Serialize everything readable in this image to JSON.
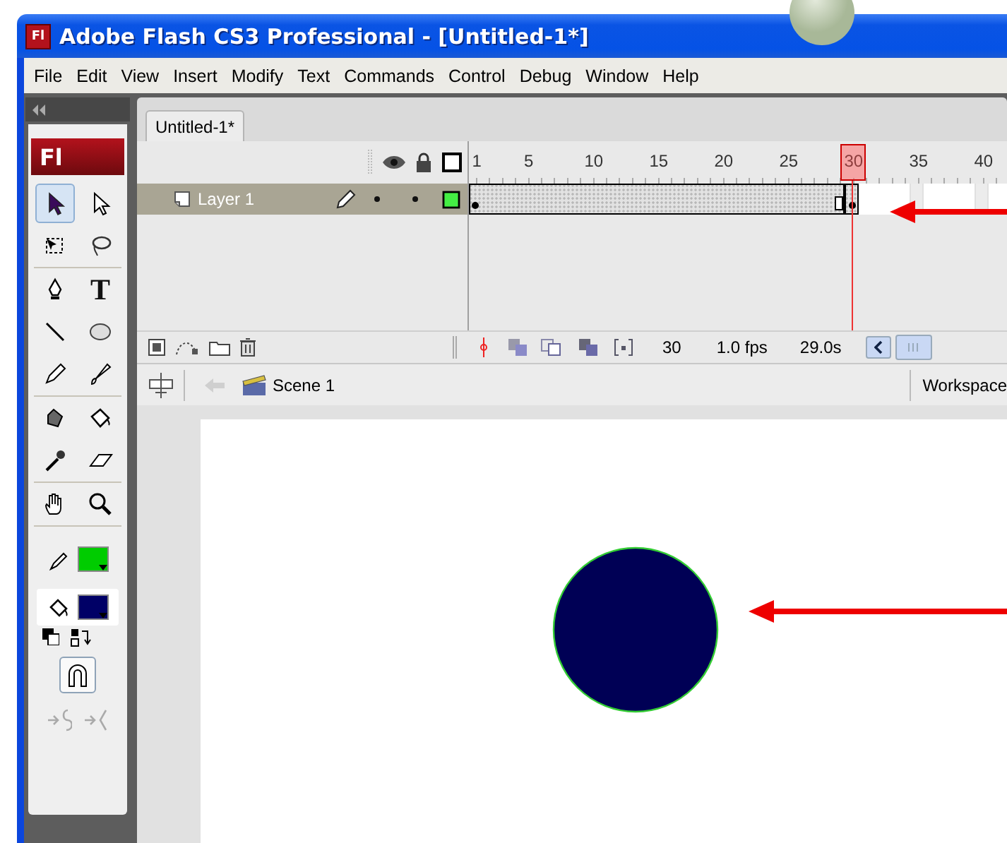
{
  "window": {
    "icon": "Fl",
    "title": "Adobe Flash CS3 Professional - [Untitled-1*]"
  },
  "menu": [
    {
      "label": "File"
    },
    {
      "label": "Edit"
    },
    {
      "label": "View"
    },
    {
      "label": "Insert"
    },
    {
      "label": "Modify"
    },
    {
      "label": "Text"
    },
    {
      "label": "Commands"
    },
    {
      "label": "Control"
    },
    {
      "label": "Debug"
    },
    {
      "label": "Window"
    },
    {
      "label": "Help"
    }
  ],
  "tools": {
    "logo": "Fl",
    "groups": [
      [
        {
          "kind": "selection",
          "selected": true
        },
        {
          "kind": "subselection",
          "selected": false
        },
        {
          "kind": "free-transform",
          "selected": false
        },
        {
          "kind": "lasso",
          "selected": false
        }
      ],
      [
        {
          "kind": "pen",
          "selected": false
        },
        {
          "kind": "text",
          "glyph": "T",
          "selected": false
        },
        {
          "kind": "line",
          "selected": false
        },
        {
          "kind": "oval",
          "selected": false
        },
        {
          "kind": "pencil",
          "selected": false
        },
        {
          "kind": "brush",
          "selected": false
        }
      ],
      [
        {
          "kind": "ink-bottle",
          "selected": false
        },
        {
          "kind": "paint-bucket",
          "selected": false
        },
        {
          "kind": "eyedropper",
          "selected": false
        },
        {
          "kind": "eraser",
          "selected": false
        }
      ],
      [
        {
          "kind": "hand",
          "selected": false
        },
        {
          "kind": "zoom",
          "selected": false
        }
      ]
    ],
    "colors": [
      {
        "kind": "stroke",
        "color": "#00cc00",
        "selected": false
      },
      {
        "kind": "fill",
        "color": "#000066",
        "selected": true
      }
    ],
    "snap": {
      "on": true
    },
    "modifiers": [
      {
        "kind": "smooth",
        "disabled": true
      },
      {
        "kind": "straighten",
        "disabled": true
      }
    ]
  },
  "documents": [
    {
      "label": "Untitled-1*",
      "selected": true
    }
  ],
  "timeline": {
    "ruler": [
      {
        "label": "1",
        "selected": false
      },
      {
        "label": "5",
        "selected": false
      },
      {
        "label": "10",
        "selected": false
      },
      {
        "label": "15",
        "selected": false
      },
      {
        "label": "20",
        "selected": false
      },
      {
        "label": "25",
        "selected": false
      },
      {
        "label": "30",
        "selected": true
      },
      {
        "label": "35",
        "selected": false
      },
      {
        "label": "40",
        "selected": false
      }
    ],
    "layers": [
      {
        "name": "Layer 1",
        "selected": true,
        "editing": true,
        "visible": true,
        "locked": false,
        "color": "#44ee44",
        "frames": [
          {
            "kind": "keyframe"
          },
          {
            "kind": "frame"
          },
          {
            "kind": "frame"
          },
          {
            "kind": "frame"
          },
          {
            "kind": "frame"
          },
          {
            "kind": "frame"
          },
          {
            "kind": "frame"
          },
          {
            "kind": "frame"
          },
          {
            "kind": "frame"
          },
          {
            "kind": "frame"
          },
          {
            "kind": "frame"
          },
          {
            "kind": "frame"
          },
          {
            "kind": "frame"
          },
          {
            "kind": "frame"
          },
          {
            "kind": "frame"
          },
          {
            "kind": "frame"
          },
          {
            "kind": "frame"
          },
          {
            "kind": "frame"
          },
          {
            "kind": "frame"
          },
          {
            "kind": "frame"
          },
          {
            "kind": "frame"
          },
          {
            "kind": "frame"
          },
          {
            "kind": "frame"
          },
          {
            "kind": "frame"
          },
          {
            "kind": "frame"
          },
          {
            "kind": "frame"
          },
          {
            "kind": "frame"
          },
          {
            "kind": "frame"
          },
          {
            "kind": "end"
          },
          {
            "kind": "keyframe"
          }
        ]
      }
    ],
    "status": {
      "frame": "30",
      "frame_rate": "1.0 fps",
      "elapsed": "29.0s"
    }
  },
  "edit_bar": {
    "scene": "Scene 1",
    "back_disabled": true,
    "workspace": "Workspace"
  },
  "stage": {
    "shapes": [
      {
        "kind": "circle"
      }
    ]
  },
  "annotations": [
    {
      "kind": "arrow"
    },
    {
      "kind": "arrow"
    }
  ]
}
